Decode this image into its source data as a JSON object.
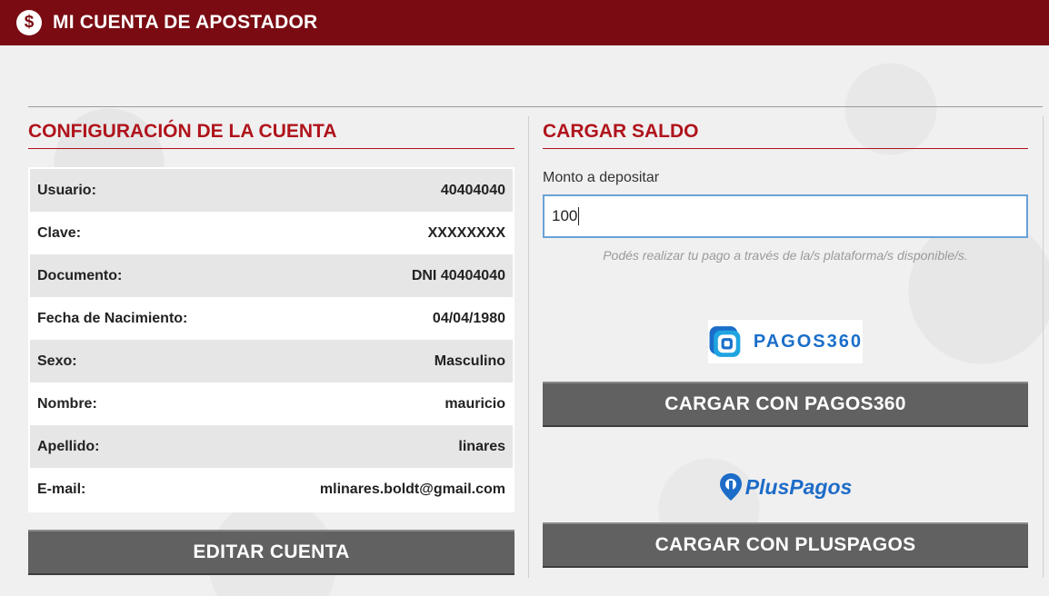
{
  "header": {
    "icon": "dollar-coin-icon",
    "title": "MI CUENTA DE APOSTADOR",
    "color": "#7a0b12"
  },
  "account": {
    "title": "CONFIGURACIÓN DE LA CUENTA",
    "rows": [
      {
        "label": "Usuario:",
        "value": "40404040"
      },
      {
        "label": "Clave:",
        "value": "XXXXXXXX"
      },
      {
        "label": "Documento:",
        "value": "DNI 40404040"
      },
      {
        "label": "Fecha de Nacimiento:",
        "value": "04/04/1980"
      },
      {
        "label": "Sexo:",
        "value": "Masculino"
      },
      {
        "label": "Nombre:",
        "value": "mauricio"
      },
      {
        "label": "Apellido:",
        "value": "linares"
      },
      {
        "label": "E-mail:",
        "value": "mlinares.boldt@gmail.com"
      }
    ],
    "edit_button": "EDITAR CUENTA"
  },
  "deposit": {
    "title": "CARGAR SALDO",
    "amount_label": "Monto a depositar",
    "amount_value": "100",
    "hint": "Podés realizar tu pago a través de la/s plataforma/s disponible/s.",
    "pagos360_logo": "PAGOS360",
    "pagos360_button": "CARGAR CON PAGOS360",
    "pluspagos_logo": "PlusPagos",
    "pluspagos_button": "CARGAR CON PLUSPAGOS"
  },
  "colors": {
    "accent_red": "#b0141c",
    "button_gray": "#616161",
    "brand_blue": "#1a6ec9"
  }
}
